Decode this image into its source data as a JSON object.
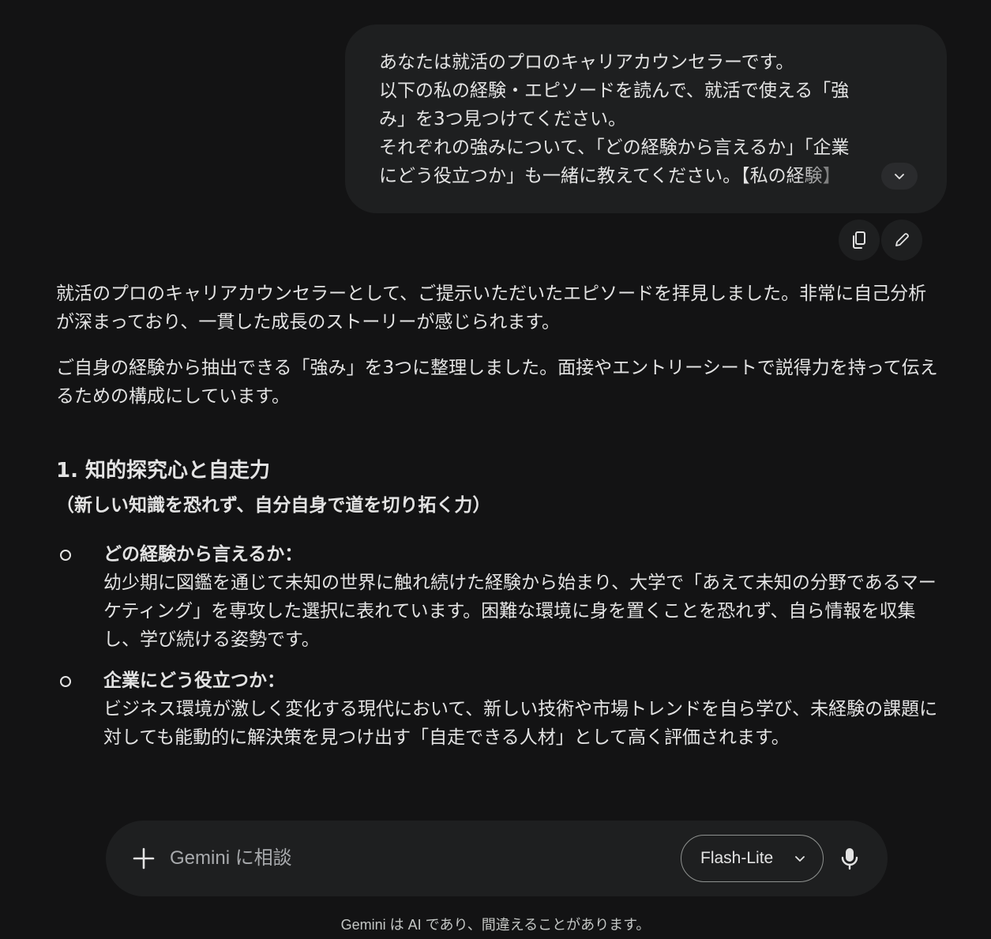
{
  "user_message": {
    "lines": [
      "あなたは就活のプロのキャリアカウンセラーです。",
      "以下の私の経験・エピソードを読んで、就活で使える「強",
      "み」を3つ見つけてください。",
      "それぞれの強みについて、「どの経験から言えるか」「企業",
      "にどう役立つか」も一緒に教えてください。"
    ],
    "faded_tail": "【私の経験】"
  },
  "response": {
    "intro_1": "就活のプロのキャリアカウンセラーとして、ご提示いただいたエピソードを拝見しました。非常に自己分析が深まっており、一貫した成長のストーリーが感じられます。",
    "intro_2": "ご自身の経験から抽出できる「強み」を3つに整理しました。面接やエントリーシートで説得力を持って伝えるための構成にしています。",
    "section_1": {
      "heading": "1. 知的探究心と自走力",
      "subtitle": "（新しい知識を恐れず、自分自身で道を切り拓く力）",
      "items": [
        {
          "label": "どの経験から言えるか：",
          "text": "幼少期に図鑑を通じて未知の世界に触れ続けた経験から始まり、大学で「あえて未知の分野であるマーケティング」を専攻した選択に表れています。困難な環境に身を置くことを恐れず、自ら情報を収集し、学び続ける姿勢です。"
        },
        {
          "label": "企業にどう役立つか：",
          "text": "ビジネス環境が激しく変化する現代において、新しい技術や市場トレンドを自ら学び、未経験の課題に対しても能動的に解決策を見つけ出す「自走できる人材」として高く評価されます。"
        }
      ]
    }
  },
  "input": {
    "placeholder": "Gemini に相談",
    "model_label": "Flash-Lite"
  },
  "disclaimer": "Gemini は AI であり、間違えることがあります。",
  "icons": {
    "expand": "chevron-down-icon",
    "copy": "copy-icon",
    "edit": "pencil-icon",
    "add": "plus-icon",
    "model_dropdown": "chevron-down-icon",
    "mic": "microphone-icon"
  },
  "colors": {
    "background": "#131314",
    "surface": "#1e1f20",
    "text": "#e3e3e3",
    "muted": "#a8aaad"
  }
}
